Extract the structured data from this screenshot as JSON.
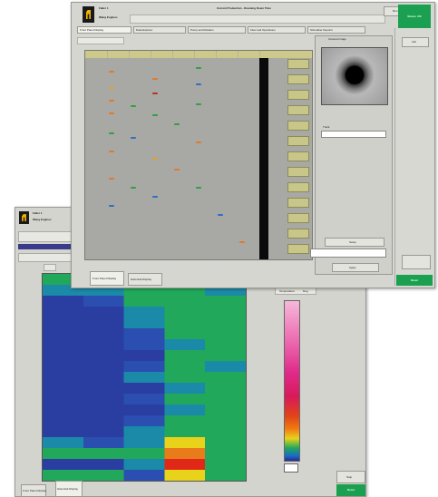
{
  "front_window": {
    "title": "Current Production - Roaming Down Time",
    "brand_line1": "Faller 1",
    "brand_line2": "Wang Engines",
    "tabs": [
      "Front Panel Display",
      "Data Explorer",
      "Pump and Rotation",
      "Flow and Operations",
      "Scheduler Reports"
    ],
    "alarm_button": "Run",
    "green_status": "Status: OK",
    "image_panel_title": "Camera Image",
    "side_buttons": [
      "Setup",
      "Apply"
    ],
    "bottom_buttons": [
      "Front Panel Display",
      "Historical Display"
    ],
    "right_buttons": [
      "Ack",
      "Reset"
    ],
    "track_label": "Track"
  },
  "back_window": {
    "brand_line1": "Faller 1",
    "brand_line2": "Wang Engines",
    "legend_title": "Temperature",
    "legend_unit": "Deg",
    "bottom_buttons": [
      "Front Panel Display",
      "Historical Display"
    ],
    "right_buttons": [
      "Stop",
      "Reset"
    ]
  },
  "colors": {
    "accent_green": "#1aa050",
    "olive": "#c9c68a"
  },
  "icons": [
    "company-logo-icon",
    "camera-ring-icon"
  ]
}
